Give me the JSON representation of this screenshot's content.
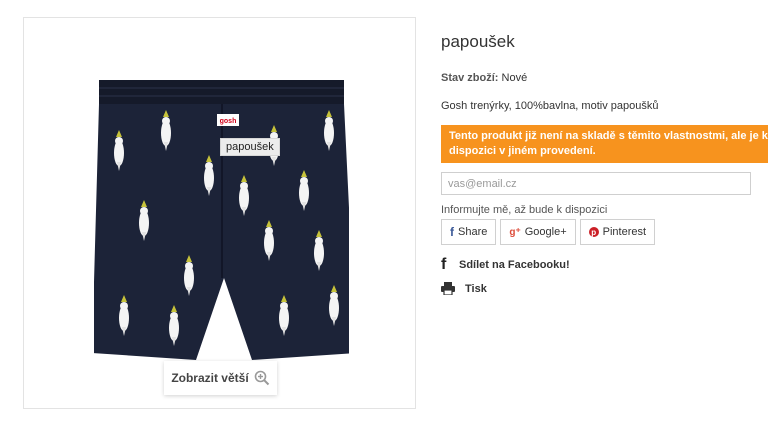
{
  "product": {
    "title": "papoušek",
    "stock_label": "Stav zboží:",
    "stock_value": "Nové",
    "description": "Gosh trenýrky, 100%bavlna, motiv papoušků",
    "image_label": "papoušek",
    "brand_tag": "gosh"
  },
  "gallery": {
    "zoom_label": "Zobrazit větší"
  },
  "availability": {
    "notice": "Tento produkt již není na skladě s těmito vlastnostmi, ale je k dispozici v jiném provedení.",
    "email_placeholder": "vas@email.cz",
    "notify_label": "Informujte mě, až bude k dispozici"
  },
  "social": {
    "buttons": [
      {
        "label": "Share",
        "icon": "facebook-icon"
      },
      {
        "label": "Google+",
        "icon": "google-plus-icon"
      },
      {
        "label": "Pinterest",
        "icon": "pinterest-icon"
      }
    ]
  },
  "actions": {
    "facebook_share": "Sdílet na Facebooku!",
    "print": "Tisk"
  },
  "colors": {
    "notice_bg": "#f7931e",
    "shorts": "#1c2338"
  }
}
